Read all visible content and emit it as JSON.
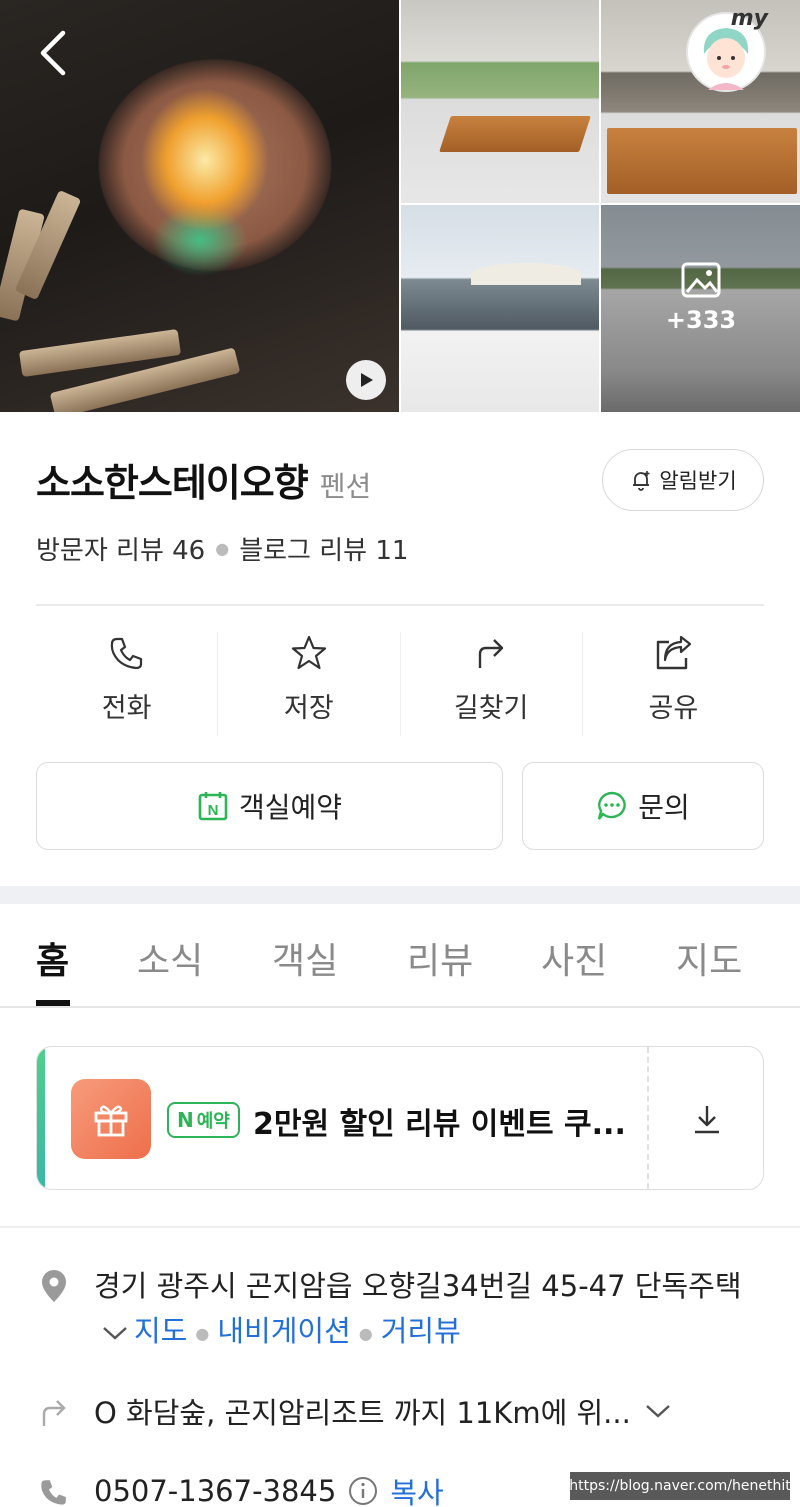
{
  "gallery": {
    "more_photos_count": "+333",
    "icons": {
      "back": "chevron-left-icon",
      "play": "play-icon",
      "photos": "image-icon",
      "profile": "my-avatar"
    },
    "my_label": "my"
  },
  "place": {
    "name": "소소한스테이오향",
    "category": "펜션",
    "notify_label": "알림받기",
    "visitor_reviews": "방문자 리뷰 46",
    "blog_reviews": "블로그 리뷰 11"
  },
  "actions": [
    {
      "label": "전화",
      "icon": "phone-icon"
    },
    {
      "label": "저장",
      "icon": "star-icon"
    },
    {
      "label": "길찾기",
      "icon": "directions-arrow-icon"
    },
    {
      "label": "공유",
      "icon": "share-icon"
    }
  ],
  "buttons": {
    "reserve_label": "객실예약",
    "inquiry_label": "문의"
  },
  "tabs": [
    {
      "label": "홈",
      "active": true
    },
    {
      "label": "소식",
      "active": false
    },
    {
      "label": "객실",
      "active": false
    },
    {
      "label": "리뷰",
      "active": false
    },
    {
      "label": "사진",
      "active": false
    },
    {
      "label": "지도",
      "active": false
    }
  ],
  "coupon": {
    "badge_n": "N",
    "badge_text": "예약",
    "text": "2만원 할인 리뷰 이벤트 쿠..."
  },
  "info": {
    "address": "경기 광주시 곤지암읍 오향길34번길 45-47 단독주택",
    "map_link": "지도",
    "navi_link": "내비게이션",
    "street_link": "거리뷰",
    "directions": "O 화담숲, 곤지암리조트 까지 11Km에 위...",
    "phone": "0507-1367-3845",
    "copy_label": "복사"
  },
  "watermark": "https://blog.naver.com/henethit",
  "colors": {
    "accent_green": "#2db457",
    "link_blue": "#2470d8",
    "gift_orange": "#ee6f4b"
  }
}
